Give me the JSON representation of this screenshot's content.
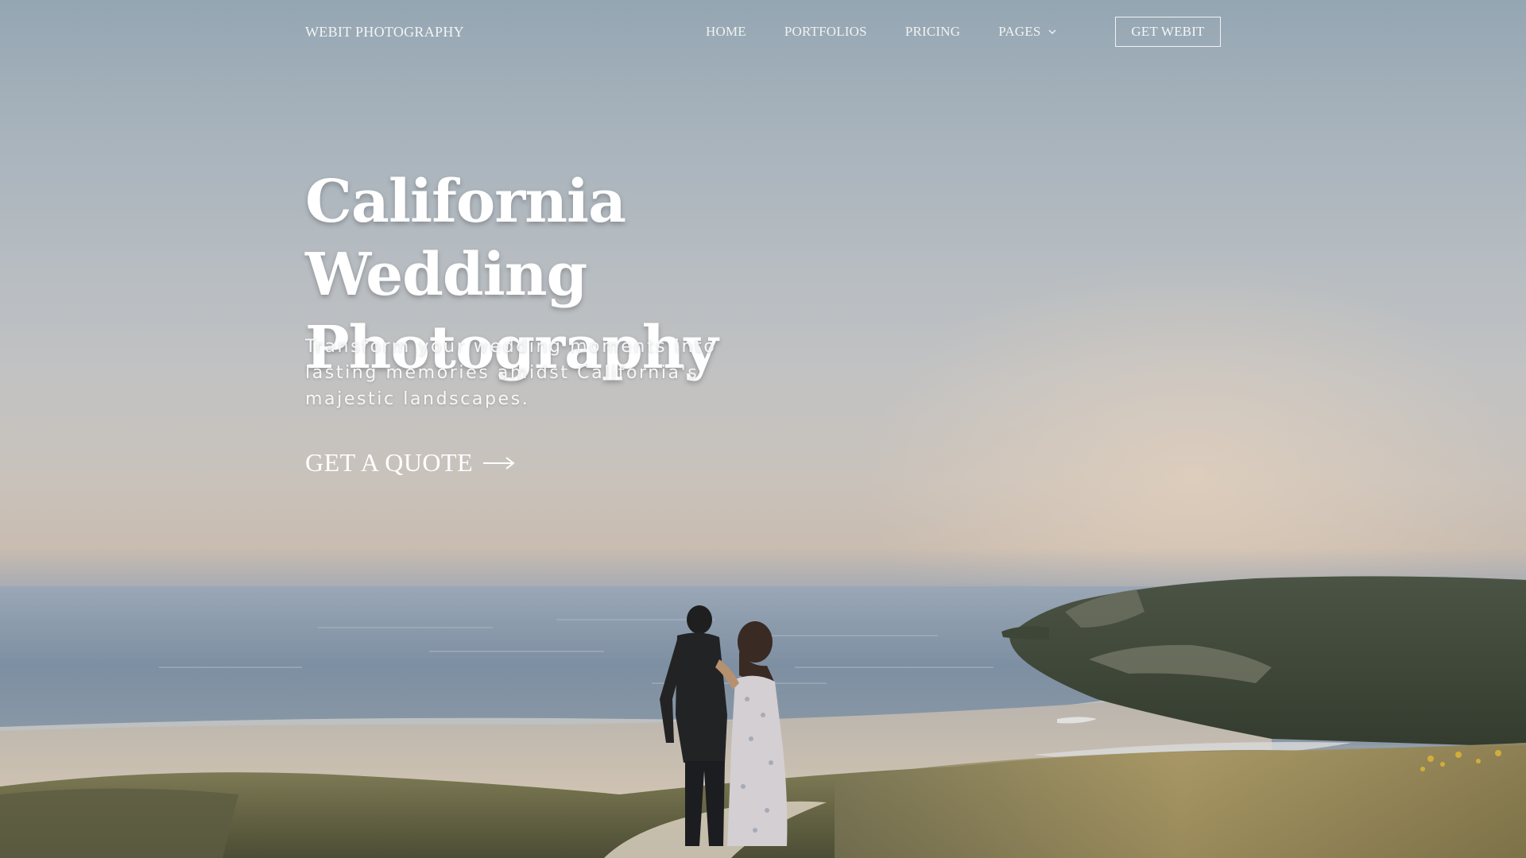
{
  "brand": {
    "name": "WEBIT PHOTOGRAPHY"
  },
  "nav": {
    "items": [
      {
        "label": "HOME"
      },
      {
        "label": "PORTFOLIOS"
      },
      {
        "label": "PRICING"
      },
      {
        "label": "PAGES",
        "icon": "chevron-down-icon"
      }
    ],
    "cta_label": "GET WEBIT"
  },
  "hero": {
    "headline_line1": "California Wedding",
    "headline_line2": "Photography",
    "subtext_line1": "Transform your wedding moments into",
    "subtext_line2": "lasting memories amidst California's",
    "subtext_line3": "majestic landscapes.",
    "cta_label": "GET A QUOTE",
    "cta_icon": "arrow-right-icon"
  },
  "colors": {
    "text": "#ffffff",
    "sky_top": "#94a6b3",
    "horizon": "#c9c2bb",
    "ocean": "#7d8fa2",
    "sand": "#c7bfb4",
    "cliff": "#3f4a38"
  }
}
